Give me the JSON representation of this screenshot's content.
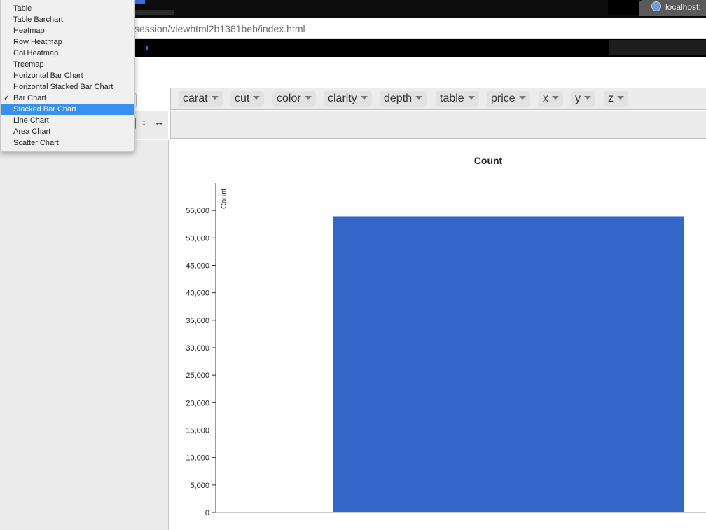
{
  "browser": {
    "tab_title": "localhost:",
    "url": "session/viewhtml2b1381beb/index.html"
  },
  "renderer_menu": {
    "items": [
      {
        "label": "Table",
        "checked": false,
        "highlighted": false
      },
      {
        "label": "Table Barchart",
        "checked": false,
        "highlighted": false
      },
      {
        "label": "Heatmap",
        "checked": false,
        "highlighted": false
      },
      {
        "label": "Row Heatmap",
        "checked": false,
        "highlighted": false
      },
      {
        "label": "Col Heatmap",
        "checked": false,
        "highlighted": false
      },
      {
        "label": "Treemap",
        "checked": false,
        "highlighted": false
      },
      {
        "label": "Horizontal Bar Chart",
        "checked": false,
        "highlighted": false
      },
      {
        "label": "Horizontal Stacked Bar Chart",
        "checked": false,
        "highlighted": false
      },
      {
        "label": "Bar Chart",
        "checked": true,
        "highlighted": false
      },
      {
        "label": "Stacked Bar Chart",
        "checked": false,
        "highlighted": true
      },
      {
        "label": "Line Chart",
        "checked": false,
        "highlighted": false
      },
      {
        "label": "Area Chart",
        "checked": false,
        "highlighted": false
      },
      {
        "label": "Scatter Chart",
        "checked": false,
        "highlighted": false
      }
    ],
    "checkmark": "✓"
  },
  "controls": {
    "row_order_glyph": "↕",
    "col_order_glyph": "↔"
  },
  "attributes": [
    "carat",
    "cut",
    "color",
    "clarity",
    "depth",
    "table",
    "price",
    "x",
    "y",
    "z"
  ],
  "colors": {
    "bar": "#3366c7",
    "menu_highlight": "#3a8ff3"
  },
  "chart_data": {
    "type": "bar",
    "title": "Count",
    "ylabel": "Count",
    "xlabel": "",
    "categories": [
      ""
    ],
    "values": [
      53940
    ],
    "ylim": [
      0,
      60000
    ],
    "yticks": [
      0,
      5000,
      10000,
      15000,
      20000,
      25000,
      30000,
      35000,
      40000,
      45000,
      50000,
      55000
    ],
    "ytick_labels": [
      "0",
      "5,000",
      "10,000",
      "15,000",
      "20,000",
      "25,000",
      "30,000",
      "35,000",
      "40,000",
      "45,000",
      "50,000",
      "55,000"
    ],
    "grid": false,
    "legend": "none"
  }
}
